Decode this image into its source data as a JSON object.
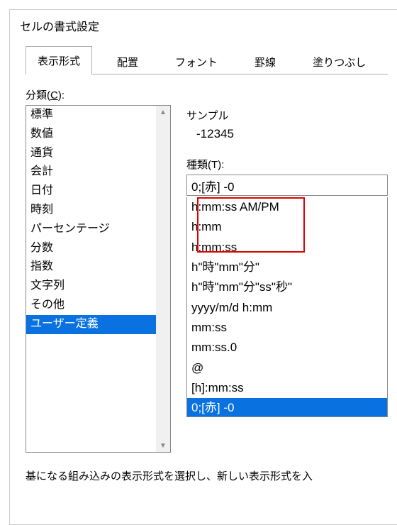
{
  "window": {
    "title": "セルの書式設定"
  },
  "tabs": [
    {
      "label": "表示形式",
      "active": true
    },
    {
      "label": "配置"
    },
    {
      "label": "フォント"
    },
    {
      "label": "罫線"
    },
    {
      "label": "塗りつぶし"
    }
  ],
  "category": {
    "label_prefix": "分類(",
    "label_key": "C",
    "label_suffix": "):",
    "items": [
      "標準",
      "数値",
      "通貨",
      "会計",
      "日付",
      "時刻",
      "パーセンテージ",
      "分数",
      "指数",
      "文字列",
      "その他",
      "ユーザー定義"
    ],
    "selected_index": 11
  },
  "sample": {
    "label": "サンプル",
    "value": "-12345"
  },
  "type": {
    "label_prefix": "種類(",
    "label_key": "T",
    "label_suffix": "):",
    "input_value": "0;[赤] -0",
    "items": [
      "h:mm:ss AM/PM",
      "h:mm",
      "h:mm:ss",
      "h\"時\"mm\"分\"",
      "h\"時\"mm\"分\"ss\"秒\"",
      "yyyy/m/d h:mm",
      "mm:ss",
      "mm:ss.0",
      "@",
      "[h]:mm:ss",
      "0;[赤] -0"
    ],
    "selected_index": 10
  },
  "bottom_text": "基になる組み込みの表示形式を選択し、新しい表示形式を入"
}
